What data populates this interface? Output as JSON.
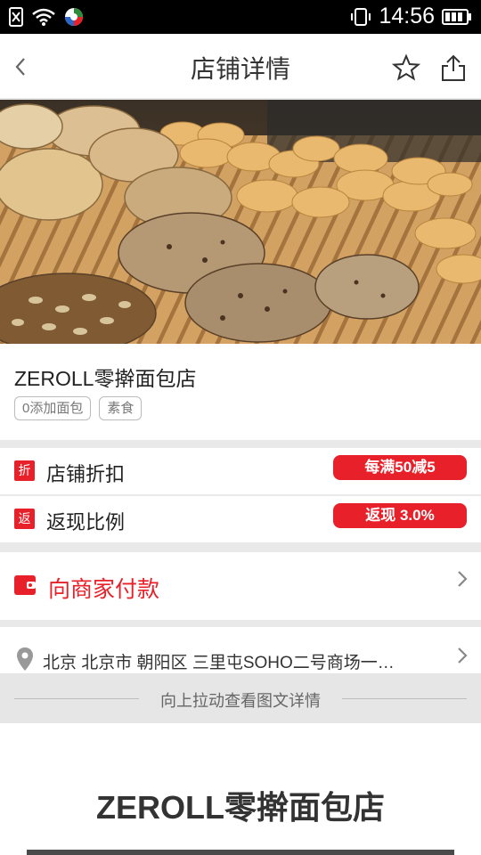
{
  "status_bar": {
    "time": "14:56"
  },
  "header": {
    "title": "店铺详情"
  },
  "shop": {
    "name": "ZEROLL零擀面包店",
    "tags": [
      "0添加面包",
      "素食"
    ]
  },
  "promotions": [
    {
      "icon": "折",
      "label": "店铺折扣",
      "badge": "每满50减5"
    },
    {
      "icon": "返",
      "label": "返现比例",
      "badge": "返现 3.0%"
    }
  ],
  "pay": {
    "label": "向商家付款"
  },
  "address": {
    "text": "北京 北京市 朝阳区 三里屯SOHO二号商场一…"
  },
  "pull_hint": "向上拉动查看图文详情",
  "detail": {
    "title": "ZEROLL零擀面包店"
  },
  "colors": {
    "accent": "#e8202a",
    "divider": "#e9e9e9"
  },
  "icons": [
    "sim-icon",
    "wifi-icon",
    "app-notification-icon",
    "vibrate-icon",
    "battery-icon",
    "back-icon",
    "star-icon",
    "share-icon",
    "wallet-icon",
    "chevron-right-icon",
    "location-pin-icon"
  ]
}
